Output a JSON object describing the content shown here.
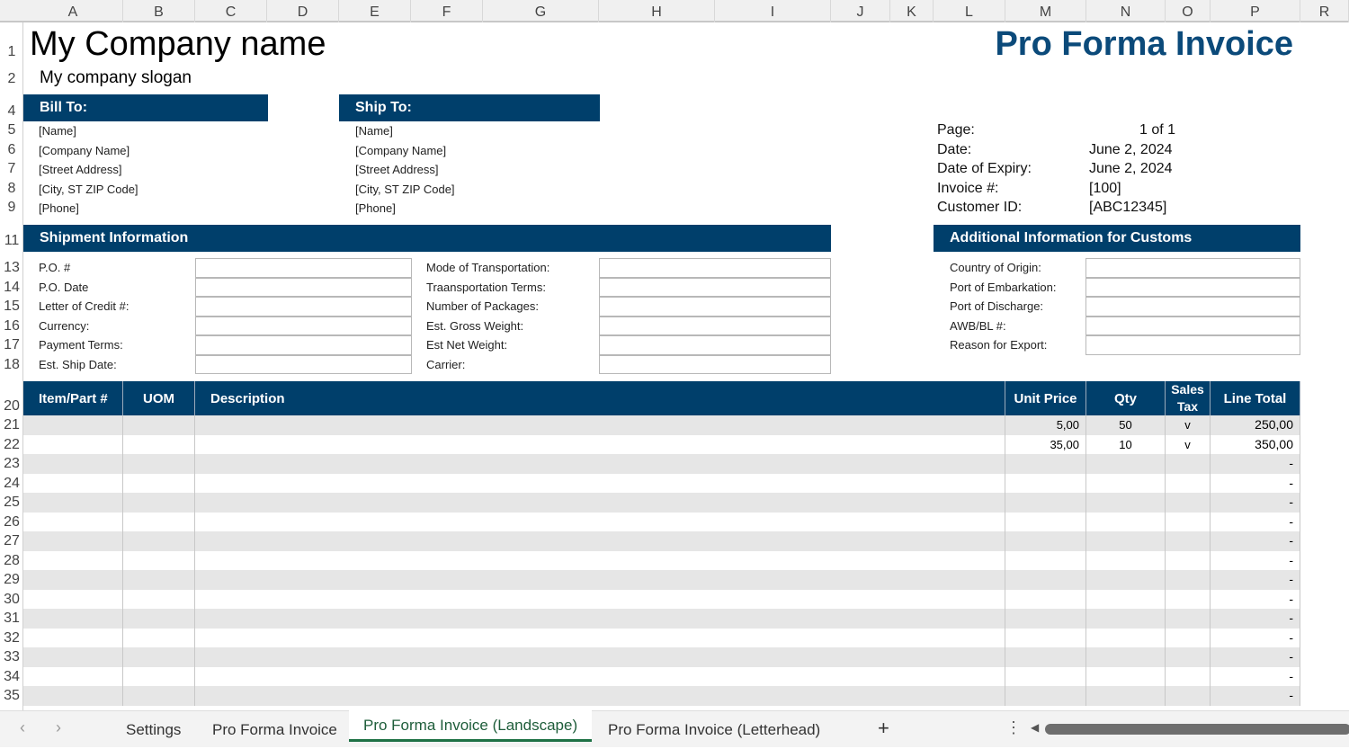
{
  "columns": [
    "A",
    "B",
    "C",
    "D",
    "E",
    "F",
    "G",
    "H",
    "I",
    "J",
    "K",
    "L",
    "M",
    "N",
    "O",
    "P",
    "R"
  ],
  "company": {
    "name": "My Company name",
    "slogan": "My company slogan"
  },
  "title": "Pro Forma Invoice",
  "bill_to": {
    "header": "Bill To:",
    "lines": [
      "[Name]",
      "[Company Name]",
      "[Street Address]",
      "[City, ST  ZIP Code]",
      "[Phone]"
    ]
  },
  "ship_to": {
    "header": "Ship To:",
    "lines": [
      "[Name]",
      "[Company Name]",
      "[Street Address]",
      "[City, ST  ZIP Code]",
      "[Phone]"
    ]
  },
  "meta": [
    {
      "label": "Page:",
      "value": "1 of  1"
    },
    {
      "label": "Date:",
      "value": "June 2, 2024"
    },
    {
      "label": "Date of Expiry:",
      "value": "June 2, 2024"
    },
    {
      "label": "Invoice #:",
      "value": "[100]"
    },
    {
      "label": "Customer ID:",
      "value": "[ABC12345]"
    }
  ],
  "shipment": {
    "header": "Shipment Information",
    "left": [
      "P.O. #",
      "P.O. Date",
      "Letter of Credit #:",
      "Currency:",
      "Payment Terms:",
      "Est. Ship Date:"
    ],
    "right": [
      "Mode of Transportation:",
      "Traansportation Terms:",
      "Number of Packages:",
      "Est. Gross Weight:",
      "Est Net Weight:",
      "Carrier:"
    ]
  },
  "customs": {
    "header": "Additional Information for Customs",
    "fields": [
      "Country of Origin:",
      "Port of Embarkation:",
      "Port of Discharge:",
      "AWB/BL #:",
      "Reason for Export:"
    ]
  },
  "items": {
    "headers": [
      "Item/Part #",
      "UOM",
      "Description",
      "Unit Price",
      "Qty",
      "Sales Tax",
      "Line Total"
    ],
    "rows": [
      [
        "",
        "",
        "",
        "5,00",
        "50",
        "v",
        "250,00"
      ],
      [
        "",
        "",
        "",
        "35,00",
        "10",
        "v",
        "350,00"
      ],
      [
        "",
        "",
        "",
        "",
        "",
        "",
        "-"
      ],
      [
        "",
        "",
        "",
        "",
        "",
        "",
        "-"
      ],
      [
        "",
        "",
        "",
        "",
        "",
        "",
        "-"
      ],
      [
        "",
        "",
        "",
        "",
        "",
        "",
        "-"
      ],
      [
        "",
        "",
        "",
        "",
        "",
        "",
        "-"
      ],
      [
        "",
        "",
        "",
        "",
        "",
        "",
        "-"
      ],
      [
        "",
        "",
        "",
        "",
        "",
        "",
        "-"
      ],
      [
        "",
        "",
        "",
        "",
        "",
        "",
        "-"
      ],
      [
        "",
        "",
        "",
        "",
        "",
        "",
        "-"
      ],
      [
        "",
        "",
        "",
        "",
        "",
        "",
        "-"
      ],
      [
        "",
        "",
        "",
        "",
        "",
        "",
        "-"
      ],
      [
        "",
        "",
        "",
        "",
        "",
        "",
        "-"
      ],
      [
        "",
        "",
        "",
        "",
        "",
        "",
        "-"
      ]
    ]
  },
  "row_numbers": {
    "top": [
      "1",
      "2",
      "4",
      "5",
      "6",
      "7",
      "8",
      "9",
      "11",
      "13",
      "14",
      "15",
      "16",
      "17",
      "18",
      "20"
    ],
    "items_start": 21
  },
  "sheet_tabs": [
    "Settings",
    "Pro Forma Invoice",
    "Pro Forma Invoice (Landscape)",
    "Pro Forma Invoice (Letterhead)"
  ],
  "active_tab": 2,
  "colors": {
    "accent": "#003f6b",
    "active_tab_underline": "#1e7145",
    "stripe": "#e6e6e6"
  }
}
